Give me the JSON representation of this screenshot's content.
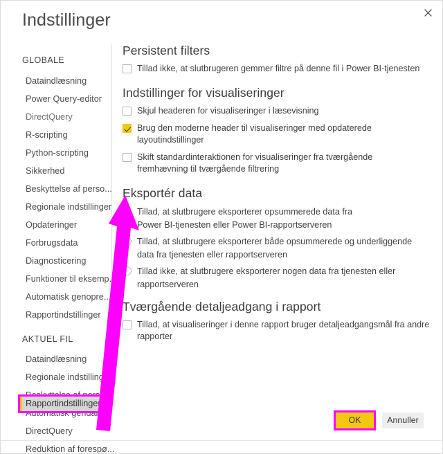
{
  "window": {
    "title": "Indstillinger",
    "close_icon": "close-icon"
  },
  "sidebar": {
    "groups": [
      {
        "title": "GLOBALE",
        "items": [
          "Dataindlæsning",
          "Power Query-editor",
          "DirectQuery",
          "R-scripting",
          "Python-scripting",
          "Sikkerhed",
          "Beskyttelse af perso...",
          "Regionale indstillinger",
          "Opdateringer",
          "Forbrugsdata",
          "Diagnosticering",
          "Funktioner til eksemp...",
          "Automatisk genopre...",
          "Rapportindstillinger"
        ]
      },
      {
        "title": "AKTUEL FIL",
        "items": [
          "Dataindlæsning",
          "Regionale indstillinger",
          "Beskyttelse af pers...",
          "Automatisk gendan ...",
          "DirectQuery",
          "Reduktion af forespø...",
          "Rapportindstillinger"
        ],
        "selected_index": 6
      }
    ]
  },
  "content": {
    "sections": [
      {
        "heading": "Persistent filters",
        "options": [
          {
            "type": "checkbox",
            "checked": false,
            "label": "Tillad ikke, at slutbrugeren gemmer filtre på denne fil i Power BI-tjenesten"
          }
        ]
      },
      {
        "heading": "Indstillinger for visualiseringer",
        "options": [
          {
            "type": "checkbox",
            "checked": false,
            "label": "Skjul headeren for visualiseringer i læsevisning"
          },
          {
            "type": "checkbox",
            "checked": true,
            "label": "Brug den moderne header til visualiseringer med opdaterede layoutindstillinger"
          },
          {
            "type": "checkbox",
            "checked": false,
            "label": "Skift standardinteraktionen for visualiseringer fra tværgående fremhævning til tværgående filtrering"
          }
        ]
      },
      {
        "heading": "Eksportér data",
        "options": [
          {
            "type": "radio",
            "checked": true,
            "label": "Tillad, at slutbrugere eksporterer opsummerede data fra Power BI-tjenesten eller Power BI-rapportserveren"
          },
          {
            "type": "radio",
            "checked": false,
            "label": "Tillad, at slutbrugere eksporterer både opsummerede og underliggende data fra tjenesten eller rapportserveren"
          },
          {
            "type": "radio",
            "checked": false,
            "label": "Tillad ikke, at slutbrugere eksporterer nogen data fra tjenesten eller rapportserveren"
          }
        ]
      },
      {
        "heading": "Tværgående detaljeadgang i rapport",
        "options": [
          {
            "type": "checkbox",
            "checked": false,
            "label": "Tillad, at visualiseringer i denne rapport bruger detaljeadgangsmål fra andre rapporter"
          }
        ]
      }
    ]
  },
  "footer": {
    "ok_label": "OK",
    "cancel_label": "Annuller"
  },
  "annotations": {
    "highlight_color": "#ff00ff",
    "accent_color": "#f2c811"
  }
}
